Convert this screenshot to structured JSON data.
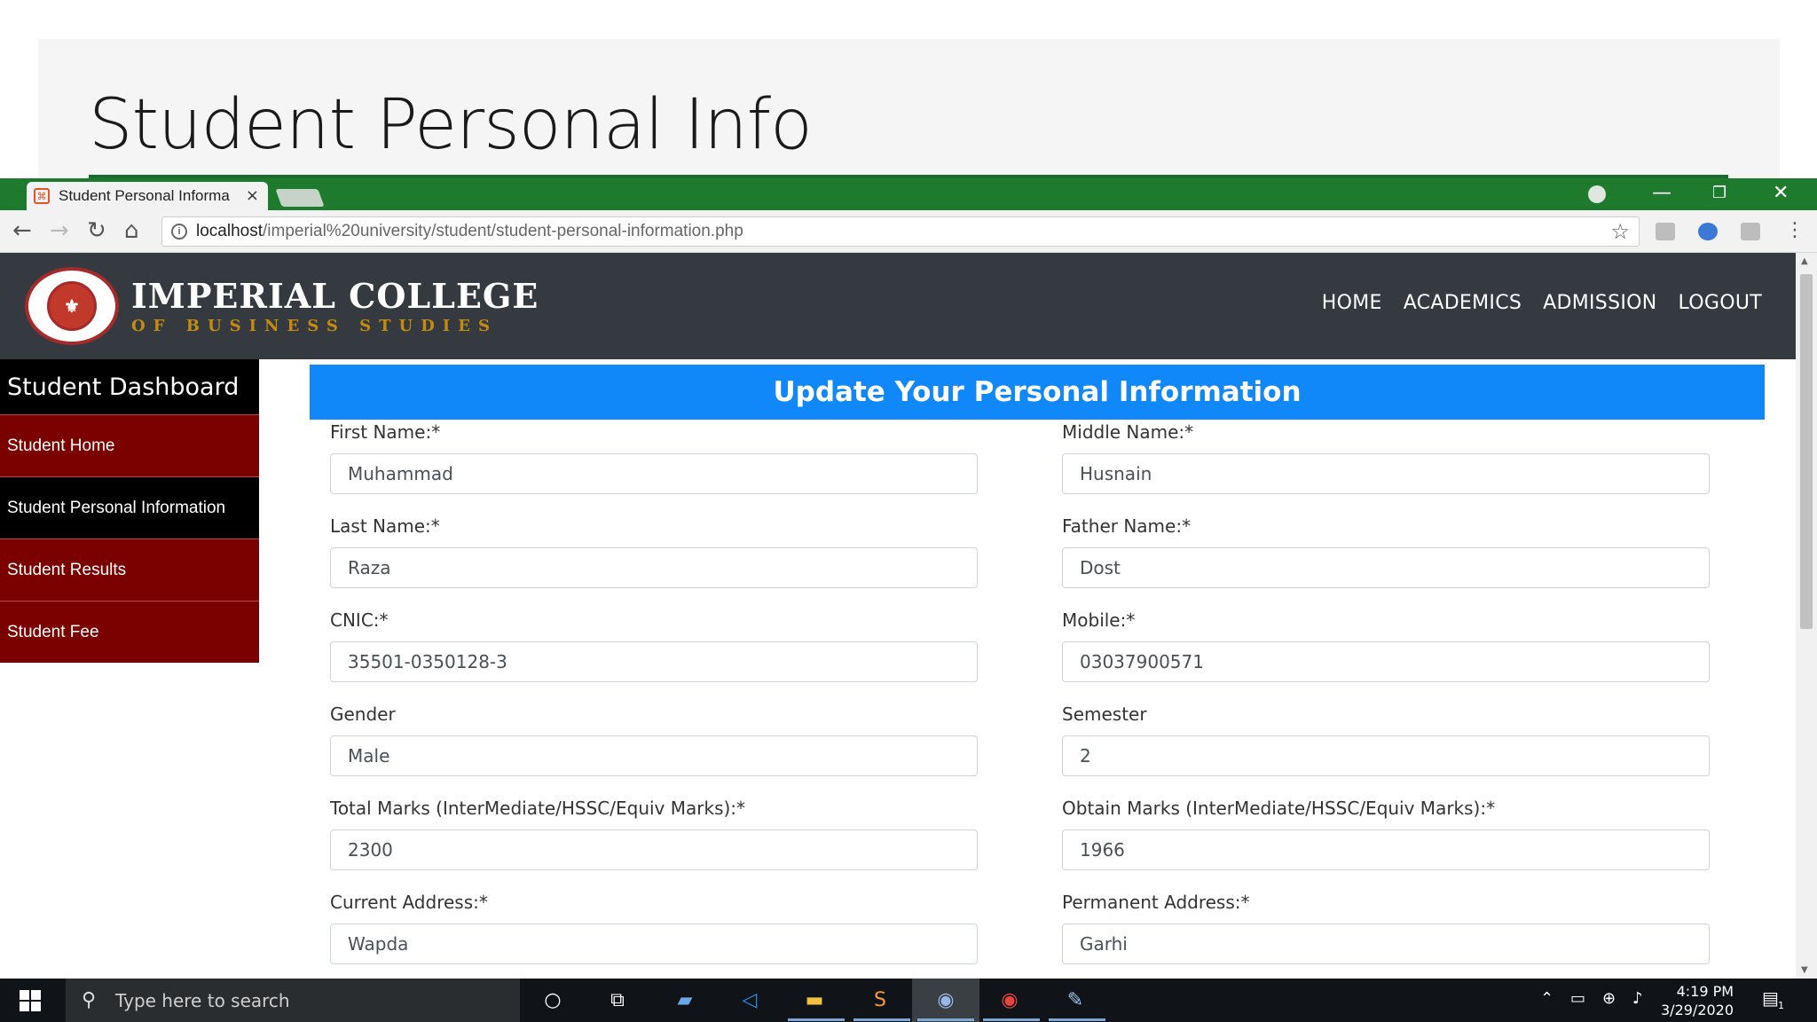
{
  "slide": {
    "title": "Student Personal Info"
  },
  "browser": {
    "tab_title": "Student Personal Informa",
    "tab_close": "×",
    "url_host": "localhost",
    "url_path": "/imperial%20university/student/student-personal-information.php",
    "min_glyph": "—",
    "max_glyph": "❐",
    "close_glyph": "✕"
  },
  "site": {
    "brand_main": "IMPERIAL COLLEGE",
    "brand_sub": "OF BUSINESS STUDIES",
    "nav": [
      "HOME",
      "ACADEMICS",
      "ADMISSION",
      "LOGOUT"
    ]
  },
  "sidebar": {
    "heading": "Student Dashboard",
    "items": [
      {
        "label": "Student Home"
      },
      {
        "label": "Student Personal Information",
        "active": true
      },
      {
        "label": "Student Results"
      },
      {
        "label": "Student Fee"
      }
    ]
  },
  "main": {
    "heading": "Update Your Personal Information",
    "fields": [
      {
        "label": "First Name:*",
        "value": "Muhammad"
      },
      {
        "label": "Middle Name:*",
        "value": "Husnain"
      },
      {
        "label": "Last Name:*",
        "value": "Raza"
      },
      {
        "label": "Father Name:*",
        "value": "Dost"
      },
      {
        "label": "CNIC:*",
        "value": "35501-0350128-3"
      },
      {
        "label": "Mobile:*",
        "value": "03037900571"
      },
      {
        "label": "Gender",
        "value": "Male"
      },
      {
        "label": "Semester",
        "value": "2"
      },
      {
        "label": "Total Marks (InterMediate/HSSC/Equiv Marks):*",
        "value": "2300"
      },
      {
        "label": "Obtain Marks (InterMediate/HSSC/Equiv Marks):*",
        "value": "1966"
      },
      {
        "label": "Current Address:*",
        "value": "Wapda"
      },
      {
        "label": "Permanent Address:*",
        "value": "Garhi"
      }
    ]
  },
  "taskbar": {
    "search_placeholder": "Type here to search",
    "time": "4:19 PM",
    "date": "3/29/2020",
    "notification_count": "1"
  }
}
